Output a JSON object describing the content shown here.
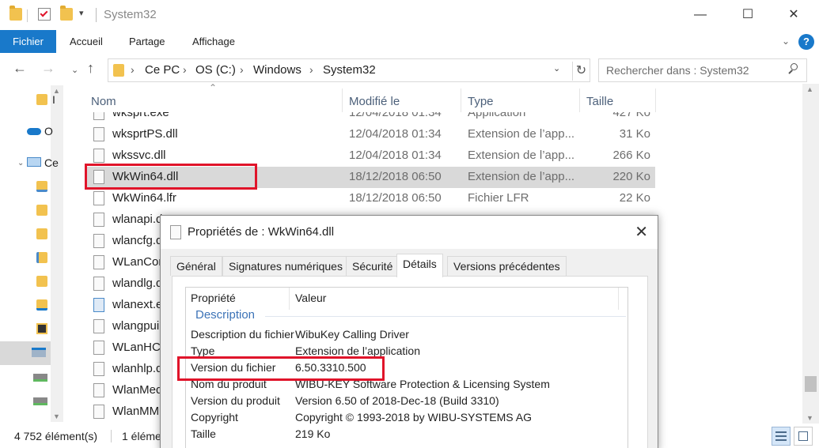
{
  "window": {
    "title": "System32",
    "controls": {
      "minimize": "—",
      "maximize": "☐",
      "close": "✕"
    }
  },
  "ribbon": {
    "tabs": [
      "Fichier",
      "Accueil",
      "Partage",
      "Affichage"
    ],
    "help_icon": "help-icon"
  },
  "address": {
    "crumbs": [
      "Ce PC",
      "OS (C:)",
      "Windows",
      "System32"
    ],
    "search_placeholder": "Rechercher dans : System32"
  },
  "nav": {
    "items": [
      {
        "label": "I",
        "icon": "folder-icon"
      },
      {
        "label": "O",
        "icon": "onedrive-icon"
      },
      {
        "label": "Ce",
        "icon": "pc-icon"
      },
      {
        "label": "",
        "icon": "desktop-folder-icon"
      },
      {
        "label": "",
        "icon": "documents-folder-icon"
      },
      {
        "label": "",
        "icon": "downloads-folder-icon"
      },
      {
        "label": "",
        "icon": "music-folder-icon"
      },
      {
        "label": "",
        "icon": "pictures-folder-icon"
      },
      {
        "label": "",
        "icon": "downloads-arrow-icon"
      },
      {
        "label": "",
        "icon": "videos-folder-icon"
      },
      {
        "label": "",
        "icon": "os-drive-icon"
      },
      {
        "label": "",
        "icon": "drive-icon"
      },
      {
        "label": "",
        "icon": "drive-icon"
      },
      {
        "label": "",
        "icon": "drive-icon"
      }
    ]
  },
  "filelist": {
    "columns": {
      "name": "Nom",
      "modified": "Modifié le",
      "type": "Type",
      "size": "Taille"
    },
    "rows": [
      {
        "name": "wksprt.exe",
        "date": "12/04/2018 01:34",
        "type": "Application",
        "size": "427 Ko"
      },
      {
        "name": "wksprtPS.dll",
        "date": "12/04/2018 01:34",
        "type": "Extension de l’app...",
        "size": "31 Ko"
      },
      {
        "name": "wkssvc.dll",
        "date": "12/04/2018 01:34",
        "type": "Extension de l’app...",
        "size": "266 Ko"
      },
      {
        "name": "WkWin64.dll",
        "date": "18/12/2018 06:50",
        "type": "Extension de l’app...",
        "size": "220 Ko",
        "selected": true
      },
      {
        "name": "WkWin64.lfr",
        "date": "18/12/2018 06:50",
        "type": "Fichier LFR",
        "size": "22 Ko"
      },
      {
        "name": "wlanapi.d",
        "date": "",
        "type": "",
        "size": ""
      },
      {
        "name": "wlancfg.d",
        "date": "",
        "type": "",
        "size": ""
      },
      {
        "name": "WLanCon",
        "date": "",
        "type": "",
        "size": ""
      },
      {
        "name": "wlandlg.d",
        "date": "",
        "type": "",
        "size": ""
      },
      {
        "name": "wlanext.e",
        "date": "",
        "type": "",
        "size": ""
      },
      {
        "name": "wlangpui",
        "date": "",
        "type": "",
        "size": ""
      },
      {
        "name": "WLanHC.",
        "date": "",
        "type": "",
        "size": ""
      },
      {
        "name": "wlanhlp.d",
        "date": "",
        "type": "",
        "size": ""
      },
      {
        "name": "WlanMed",
        "date": "",
        "type": "",
        "size": ""
      },
      {
        "name": "WlanMM",
        "date": "",
        "type": "",
        "size": ""
      }
    ]
  },
  "status": {
    "count": "4 752 élément(s)",
    "selection": "1 éléme"
  },
  "dialog": {
    "title": "Propriétés de : WkWin64.dll",
    "close": "✕",
    "tabs": [
      "Général",
      "Signatures numériques",
      "Sécurité",
      "Détails",
      "Versions précédentes"
    ],
    "active_tab": "Détails",
    "columns": {
      "property": "Propriété",
      "value": "Valeur"
    },
    "group": "Description",
    "rows": [
      {
        "key": "Description du fichier",
        "value": "WibuKey Calling Driver"
      },
      {
        "key": "Type",
        "value": "Extension de l’application"
      },
      {
        "key": "Version du fichier",
        "value": "6.50.3310.500"
      },
      {
        "key": "Nom du produit",
        "value": "WIBU-KEY Software Protection & Licensing System"
      },
      {
        "key": "Version du produit",
        "value": "Version 6.50 of 2018-Dec-18 (Build 3310)"
      },
      {
        "key": "Copyright",
        "value": "Copyright © 1993-2018 by WIBU-SYSTEMS AG"
      },
      {
        "key": "Taille",
        "value": "219 Ko"
      }
    ]
  },
  "colors": {
    "accent": "#1979ca",
    "highlight": "#e0142a",
    "selection": "#d9d9d9"
  }
}
